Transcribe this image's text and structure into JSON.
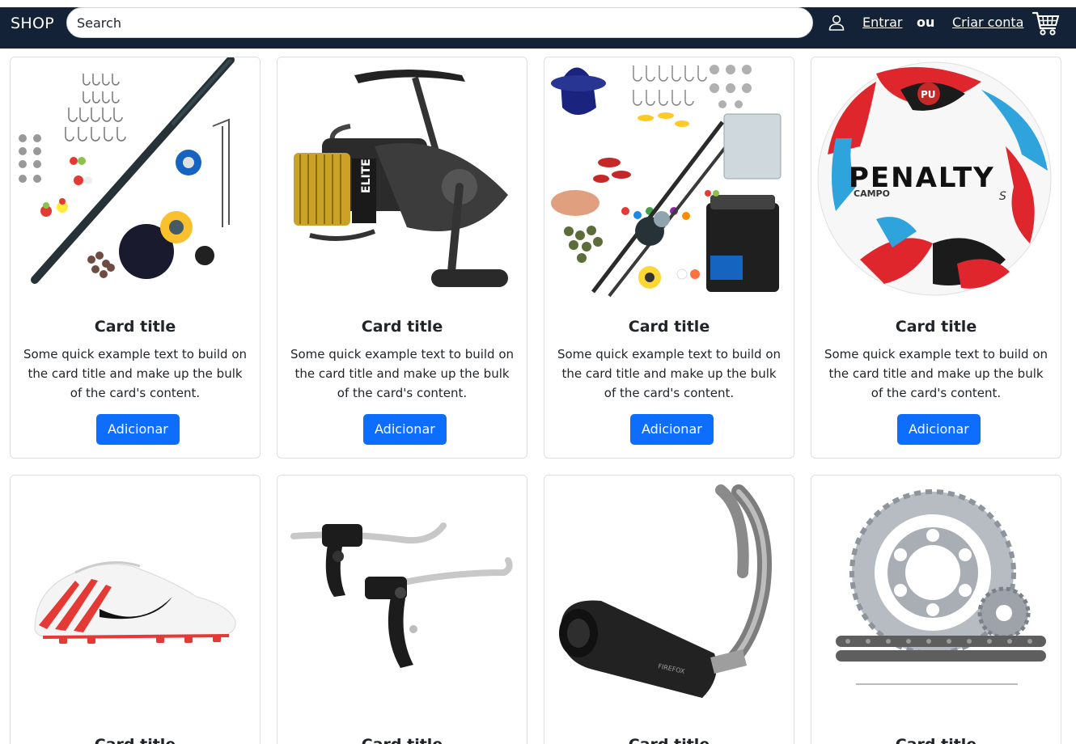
{
  "navbar": {
    "brand": "SHOP",
    "search_placeholder": "Search",
    "login_label": "Entrar",
    "or_label": "ou",
    "register_label": "Criar conta",
    "bg_color": "#132237"
  },
  "accent_color": "#0d6efd",
  "cards": [
    {
      "title": "Card title",
      "text": "Some quick example text to build on the card title and make up the bulk of the card's content.",
      "button": "Adicionar",
      "image": "fishing-kit-image"
    },
    {
      "title": "Card title",
      "text": "Some quick example text to build on the card title and make up the bulk of the card's content.",
      "button": "Adicionar",
      "image": "fishing-reel-image"
    },
    {
      "title": "Card title",
      "text": "Some quick example text to build on the card title and make up the bulk of the card's content.",
      "button": "Adicionar",
      "image": "fishing-accessories-image"
    },
    {
      "title": "Card title",
      "text": "Some quick example text to build on the card title and make up the bulk of the card's content.",
      "button": "Adicionar",
      "image": "soccer-ball-image"
    },
    {
      "title": "Card title",
      "image": "soccer-cleat-image"
    },
    {
      "title": "Card title",
      "image": "brake-levers-image"
    },
    {
      "title": "Card title",
      "image": "exhaust-pipe-image"
    },
    {
      "title": "Card title",
      "image": "sprocket-chain-image"
    }
  ]
}
